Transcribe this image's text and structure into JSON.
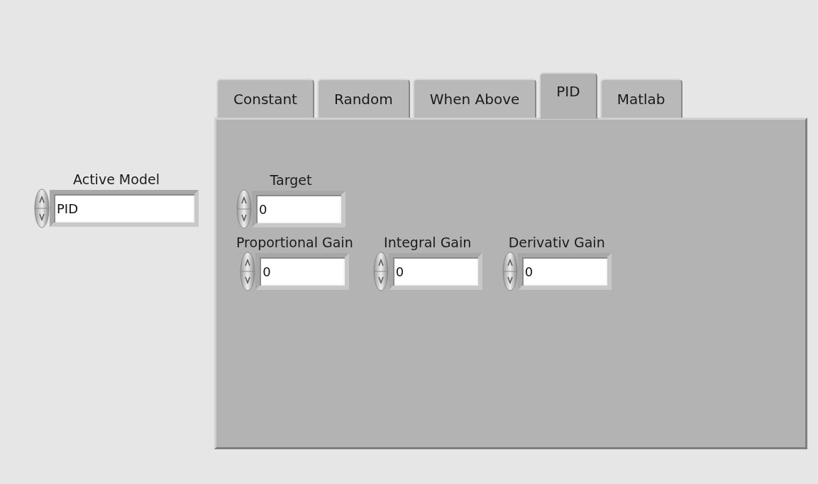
{
  "active_model": {
    "label": "Active Model",
    "value": "PID"
  },
  "tabs": [
    {
      "label": "Constant",
      "selected": false
    },
    {
      "label": "Random",
      "selected": false
    },
    {
      "label": "When Above",
      "selected": false
    },
    {
      "label": "PID",
      "selected": true
    },
    {
      "label": "Matlab",
      "selected": false
    }
  ],
  "pid_fields": [
    {
      "label": "Target",
      "value": "0"
    },
    {
      "label": "Proportional Gain",
      "value": "0"
    },
    {
      "label": "Integral Gain",
      "value": "0"
    },
    {
      "label": "Derivativ Gain",
      "value": "0"
    }
  ]
}
